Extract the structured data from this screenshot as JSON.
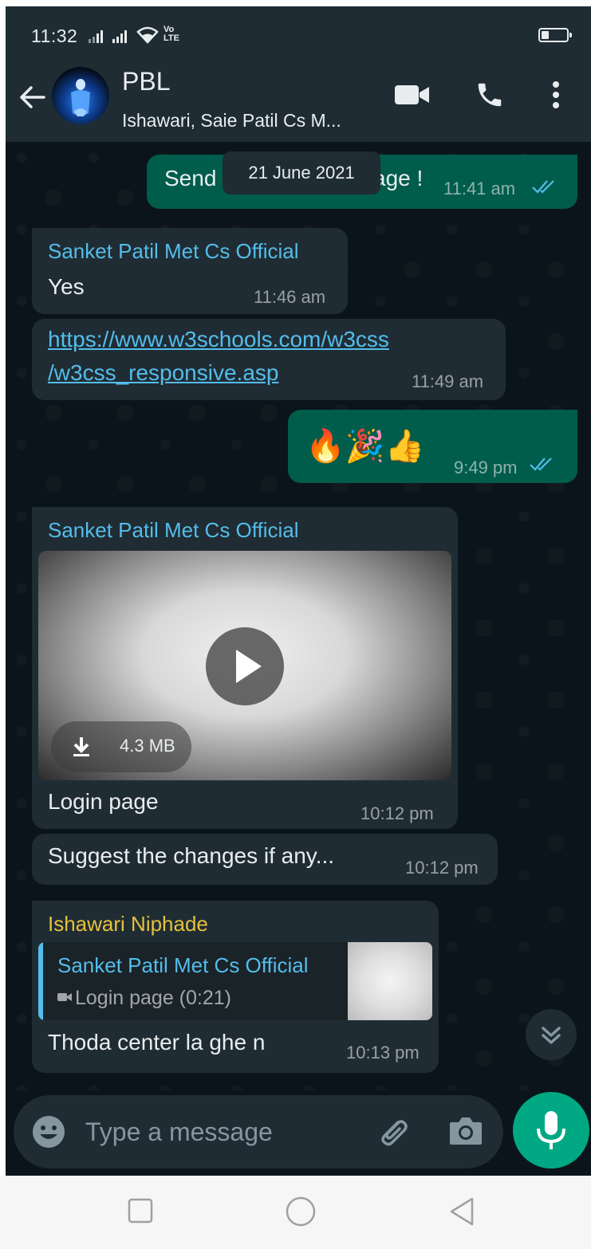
{
  "status_bar": {
    "time": "11:32",
    "network_label": "Vo LTE"
  },
  "header": {
    "title": "PBL",
    "subtitle": "Ishawari, Saie Patil Cs M..."
  },
  "chat": {
    "date_pill": "21 June 2021",
    "messages": [
      {
        "type": "outgoing",
        "text": "Send",
        "text_tail": "age !",
        "time": "11:41 am"
      },
      {
        "type": "incoming",
        "sender": "Sanket Patil Met Cs Official",
        "text": "Yes",
        "time": "11:46 am"
      },
      {
        "type": "incoming",
        "text_line1": "https://www.w3schools.com/w3css",
        "text_line2": "/w3css_responsive.asp",
        "time": "11:49 am"
      },
      {
        "type": "outgoing",
        "text": "🔥🎉👍",
        "time": "9:49 pm"
      },
      {
        "type": "incoming",
        "sender": "Sanket Patil Met Cs Official",
        "video_size": "4.3 MB",
        "caption": "Login page",
        "time": "10:12 pm"
      },
      {
        "type": "incoming",
        "text": "Suggest the changes if any...",
        "time": "10:12 pm"
      },
      {
        "type": "incoming",
        "sender": "Ishawari Niphade",
        "quote_sender": "Sanket Patil Met Cs Official",
        "quote_text": "Login page (0:21)",
        "text": "Thoda center la ghe n",
        "time": "10:13 pm"
      }
    ]
  },
  "composer": {
    "placeholder": "Type a message"
  },
  "colors": {
    "background": "#0b141a",
    "bar": "#1f2c34",
    "incoming_bubble": "#202c33",
    "outgoing_bubble": "#005c4b",
    "accent": "#00a884",
    "sender_teal": "#53bdeb",
    "sender_gold": "#e5c13d",
    "read_ticks": "#53bdeb"
  },
  "battery_level": 0.3
}
